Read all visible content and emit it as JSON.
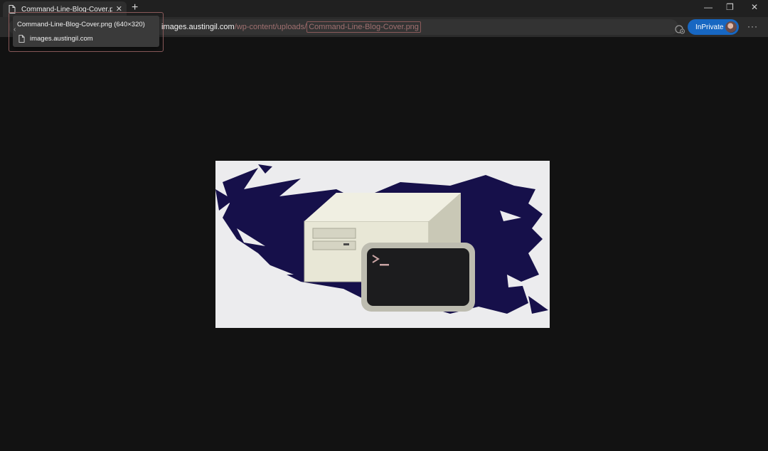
{
  "tab": {
    "title": "Command-Line-Blog-Cover.png",
    "close_glyph": "✕",
    "icon": "document-icon"
  },
  "new_tab_glyph": "+",
  "window_controls": {
    "minimize": "—",
    "restore": "❐",
    "close": "✕"
  },
  "address_bar": {
    "host": "images.austingil.com",
    "path": "/wp-content/uploads/",
    "file": "Command-Line-Blog-Cover.png"
  },
  "tooltip": {
    "title": "Command-Line-Blog-Cover.png (640×320)",
    "host": "images.austingil.com"
  },
  "profile": {
    "label": "InPrivate"
  },
  "more_glyph": "···",
  "colors": {
    "accent": "#1767c2",
    "highlight_border": "#8a5a5a",
    "page_background": "#121212",
    "brush_stroke": "#16104a"
  }
}
